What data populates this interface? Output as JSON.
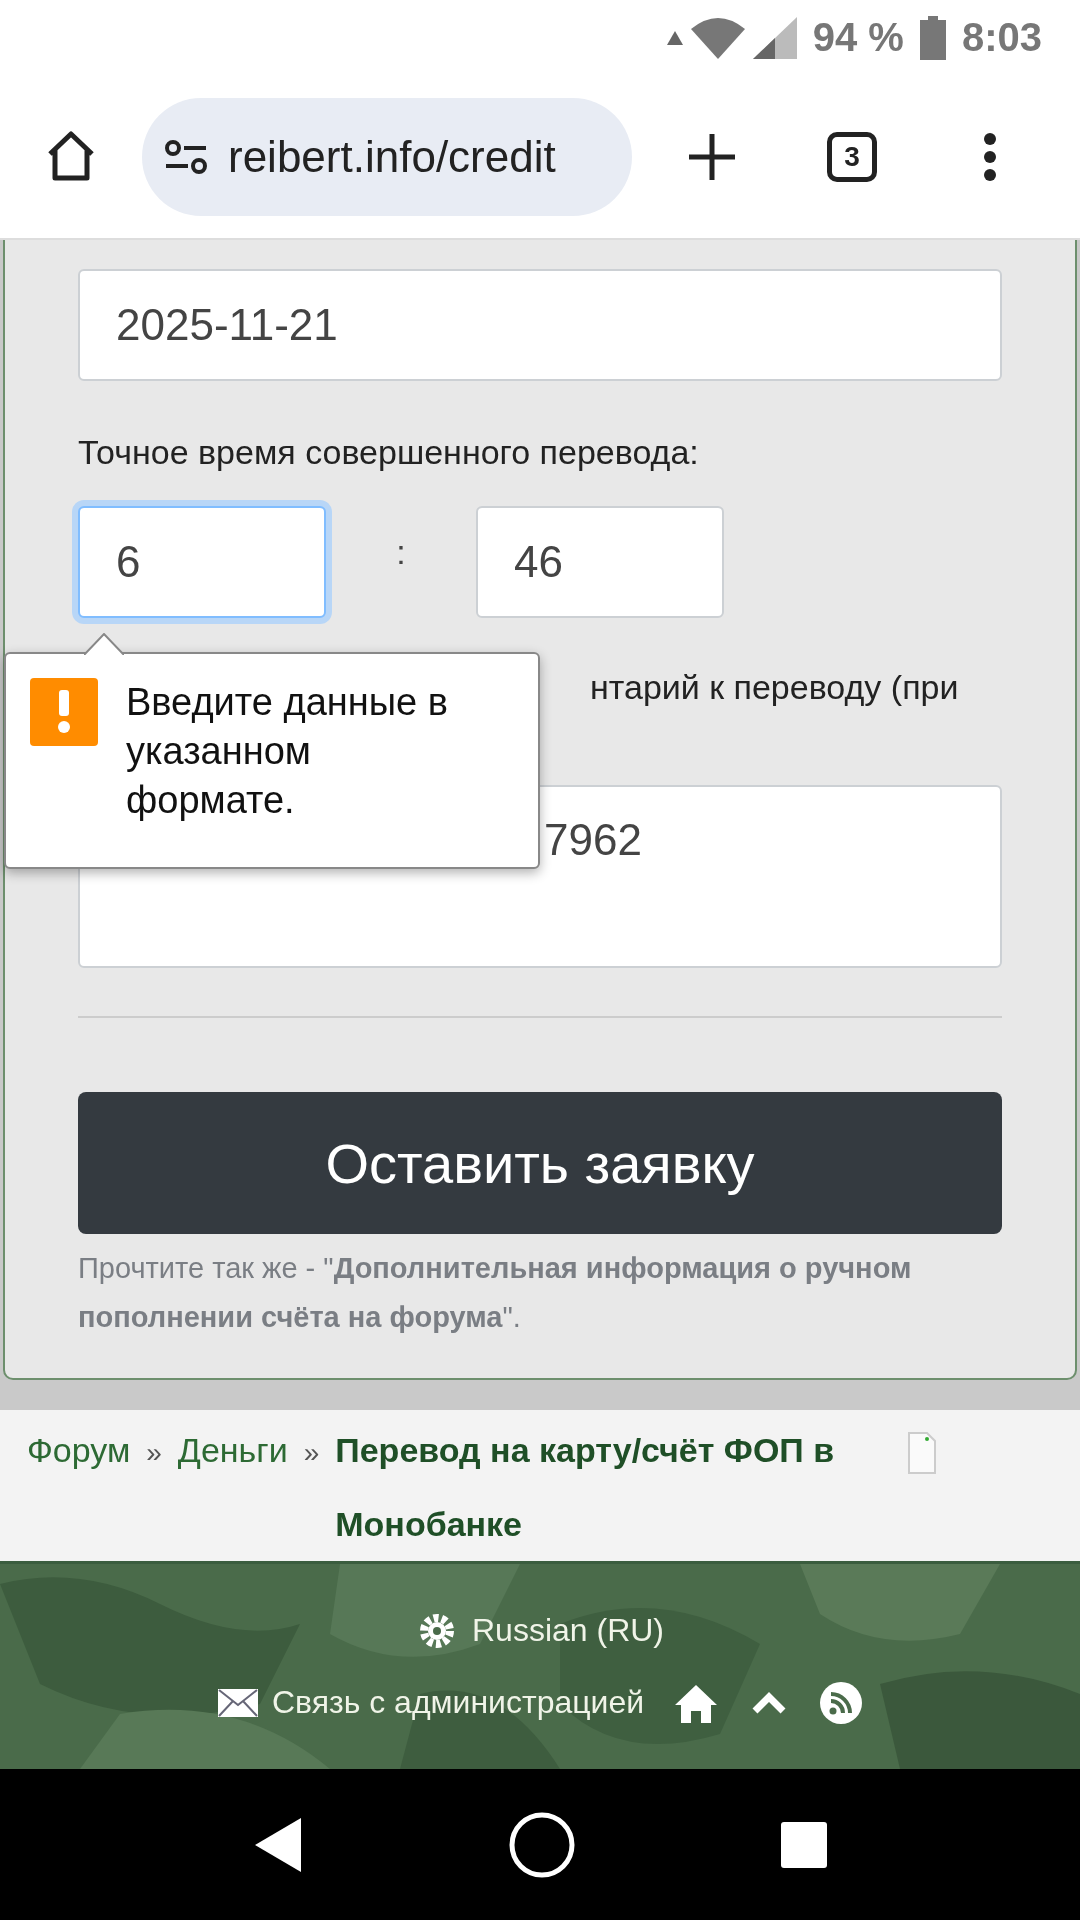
{
  "status_bar": {
    "battery": "94 %",
    "time": "8:03"
  },
  "browser": {
    "url": "reibert.info/credit",
    "tab_count": "3"
  },
  "form": {
    "date_value": "2025-11-21",
    "time_label": "Точное время совершенного перевода:",
    "hour_value": "6",
    "hour_focused": true,
    "separator": ":",
    "minute_value": "46",
    "comment_label": "нтарий к переводу (при",
    "comment_value": "7962",
    "submit": "Оставить заявку",
    "note": "Прочтите так же - \"**Дополнительная информация о ручном пополнении счёта на форума**\"."
  },
  "tooltip": {
    "message": "Введите данные в указанном формате."
  },
  "breadcrumbs": [
    {
      "label": "Форум",
      "separator": "»",
      "current": false
    },
    {
      "label": "Деньги",
      "separator": "»",
      "current": false
    },
    {
      "label": "Перевод на карту/счёт ФОП в Монобанке",
      "current": true
    }
  ],
  "footer": {
    "language": "Russian (RU)",
    "contact": "Связь с администрацией"
  }
}
